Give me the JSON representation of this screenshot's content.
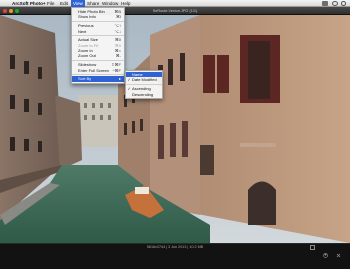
{
  "menubar": {
    "app_name": "ArcSoft Photo+",
    "menus": [
      "File",
      "Edit",
      "View",
      "Share",
      "Window",
      "Help"
    ],
    "active_menu": "View"
  },
  "window": {
    "title": "SeRoute.Venice.JPG (1/1)"
  },
  "view_menu": {
    "items": [
      {
        "label": "Hide Photo Bin",
        "shortcut": "⌘B",
        "disabled": false
      },
      {
        "label": "Show Info",
        "shortcut": "⌘I",
        "disabled": false
      },
      {
        "label": "Previous",
        "shortcut": "⌥↑",
        "disabled": false
      },
      {
        "label": "Next",
        "shortcut": "⌥↓",
        "disabled": false
      },
      {
        "label": "Actual Size",
        "shortcut": "⌘0",
        "disabled": false
      },
      {
        "label": "Zoom to Fit",
        "shortcut": "⌘9",
        "disabled": true
      },
      {
        "label": "Zoom In",
        "shortcut": "⌘=",
        "disabled": false
      },
      {
        "label": "Zoom Out",
        "shortcut": "⌘-",
        "disabled": false
      },
      {
        "label": "Slideshow",
        "shortcut": "⇧⌘F",
        "disabled": false
      },
      {
        "label": "Enter Full Screen",
        "shortcut": "^⌘F",
        "disabled": false
      },
      {
        "label": "Sort By",
        "shortcut": "",
        "disabled": false,
        "highlighted": true
      }
    ]
  },
  "sort_submenu": {
    "items": [
      {
        "label": "Name",
        "checked": false,
        "highlighted": true
      },
      {
        "label": "Date Modified",
        "checked": true,
        "highlighted": false
      },
      {
        "label": "Ascending",
        "checked": true,
        "highlighted": false
      },
      {
        "label": "Descending",
        "checked": false,
        "highlighted": false
      }
    ]
  },
  "status": {
    "info": "5616x3744 | 3 Jun 2013 | 10.2 MB"
  },
  "icons": {
    "apple": "apple-icon",
    "fullscreen": "fullscreen-icon",
    "share": "share-icon",
    "close": "close-icon"
  },
  "colors": {
    "menu_highlight": "#2f63d3",
    "close_button": "#e0443e",
    "minimize_button": "#dea123",
    "zoom_button": "#1aab29"
  }
}
